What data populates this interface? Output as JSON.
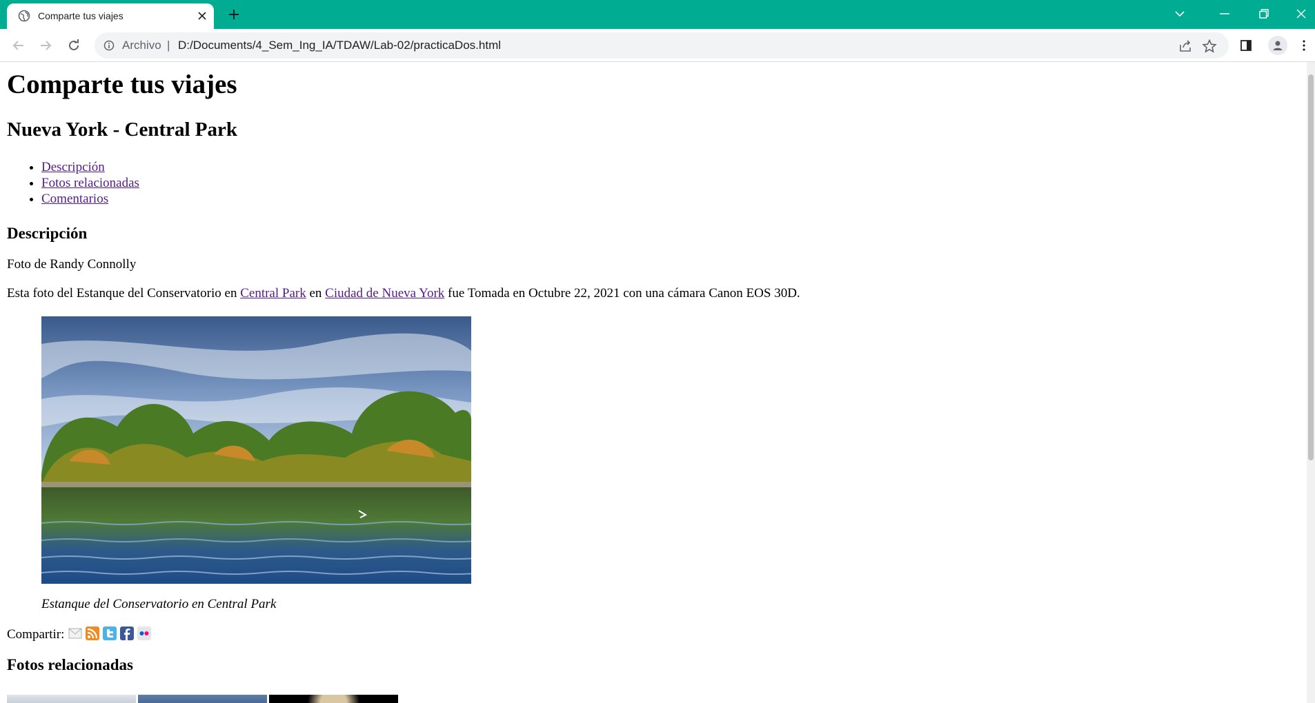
{
  "browser": {
    "tab_title": "Comparte tus viajes",
    "address_scheme": "Archivo",
    "address_separator": "|",
    "address_url": "D:/Documents/4_Sem_Ing_IA/TDAW/Lab-02/practicaDos.html",
    "accent_color": "#00ad92"
  },
  "page": {
    "title": "Comparte tus viajes",
    "subtitle": "Nueva York - Central Park",
    "toc": [
      {
        "label": "Descripción"
      },
      {
        "label": "Fotos relacionadas"
      },
      {
        "label": "Comentarios"
      }
    ],
    "description_heading": "Descripción",
    "author_text": "Foto de Randy Connolly",
    "desc_prefix": "Esta foto del Estanque del Conservatorio en ",
    "link_central_park": "Central Park",
    "desc_middle": " en ",
    "link_nyc": "Ciudad de Nueva York",
    "desc_suffix": " fue Tomada en Octubre 22, 2021 con una cámara Canon EOS 30D.",
    "caption": "Estanque del Conservatorio en Central Park",
    "share_label": "Compartir:",
    "share_icons": [
      "email-icon",
      "rss-icon",
      "twitter-icon",
      "facebook-icon",
      "flickr-icon"
    ],
    "related_heading": "Fotos relacionadas"
  }
}
